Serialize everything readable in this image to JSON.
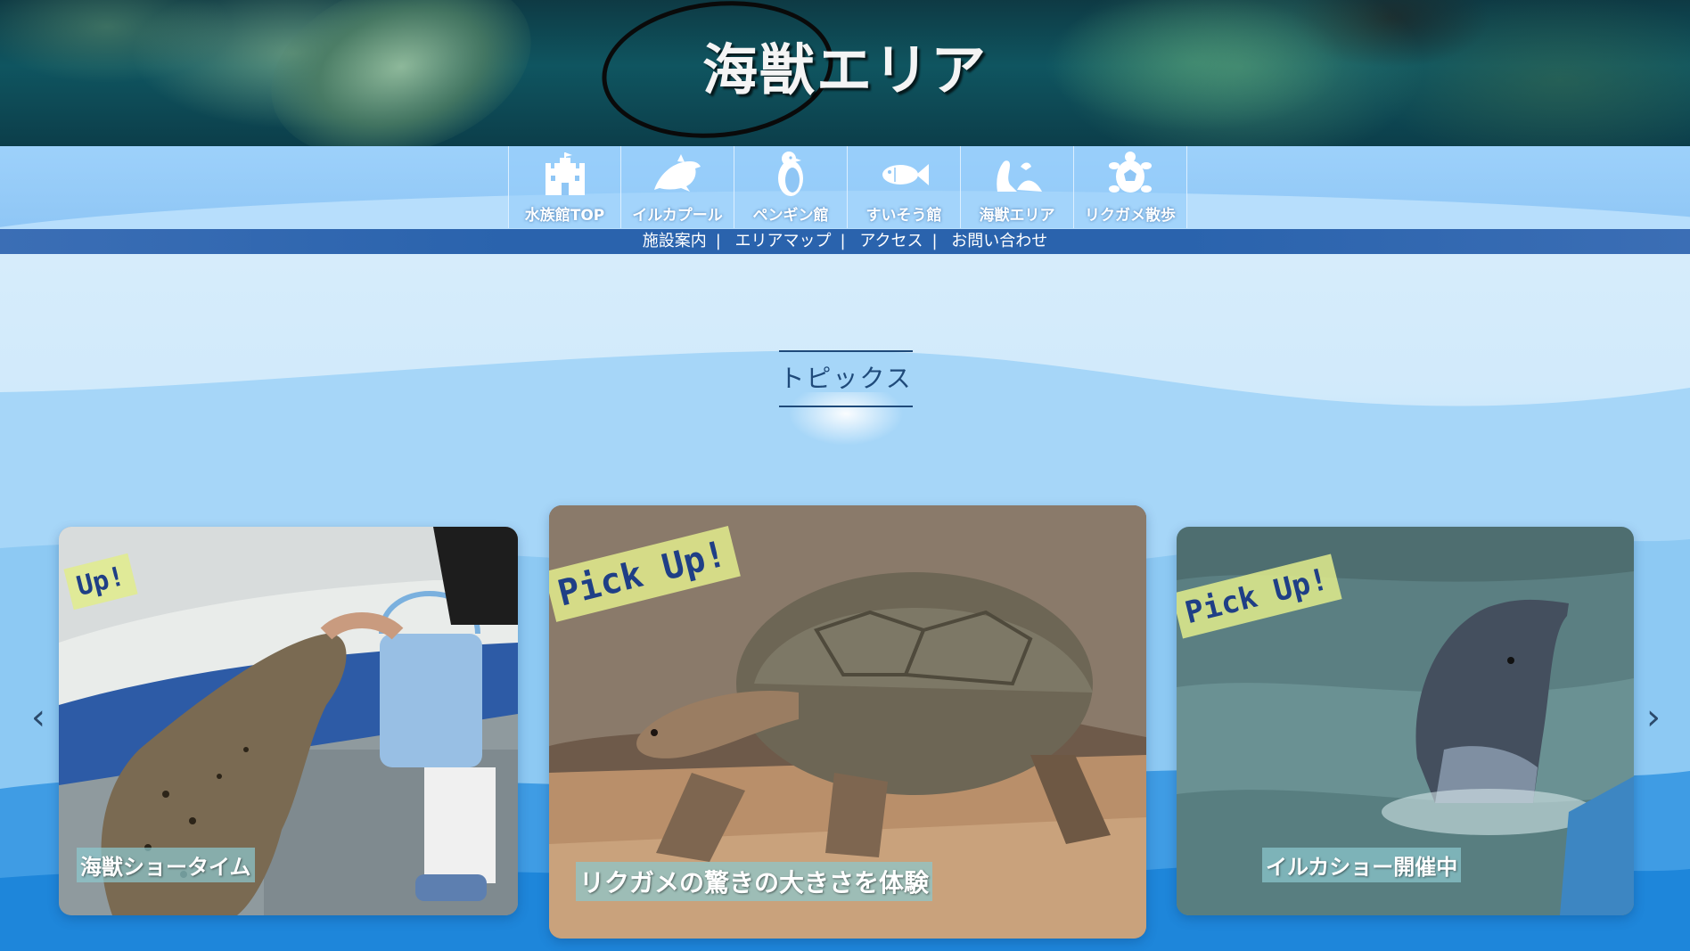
{
  "hero": {
    "title": "海獣エリア"
  },
  "nav": {
    "items": [
      {
        "label": "水族館TOP",
        "icon": "castle-icon"
      },
      {
        "label": "イルカプール",
        "icon": "dolphin-icon"
      },
      {
        "label": "ペンギン館",
        "icon": "penguin-icon"
      },
      {
        "label": "すいそう館",
        "icon": "fish-icon"
      },
      {
        "label": "海獣エリア",
        "icon": "seal-icon"
      },
      {
        "label": "リクガメ散歩",
        "icon": "turtle-icon"
      }
    ]
  },
  "sub_nav": {
    "links": [
      "施設案内",
      "エリアマップ",
      "アクセス",
      "お問い合わせ"
    ],
    "separator": "|"
  },
  "topics": {
    "title": "トピックス",
    "prev_icon": "chevron-left-icon",
    "next_icon": "chevron-right-icon",
    "cards": [
      {
        "badge": "Up!",
        "caption": "海獣ショータイム"
      },
      {
        "badge": "Pick Up!",
        "caption": "リクガメの驚きの大きさを体験"
      },
      {
        "badge": "Pick Up!",
        "caption": "イルカショー開催中"
      }
    ]
  },
  "colors": {
    "nav_background": "#9dd1fb",
    "sub_bar": "#2a63ad",
    "title_text": "#1f4a7a",
    "badge_background": "#e2ec8c",
    "badge_text": "#1f3f86"
  }
}
